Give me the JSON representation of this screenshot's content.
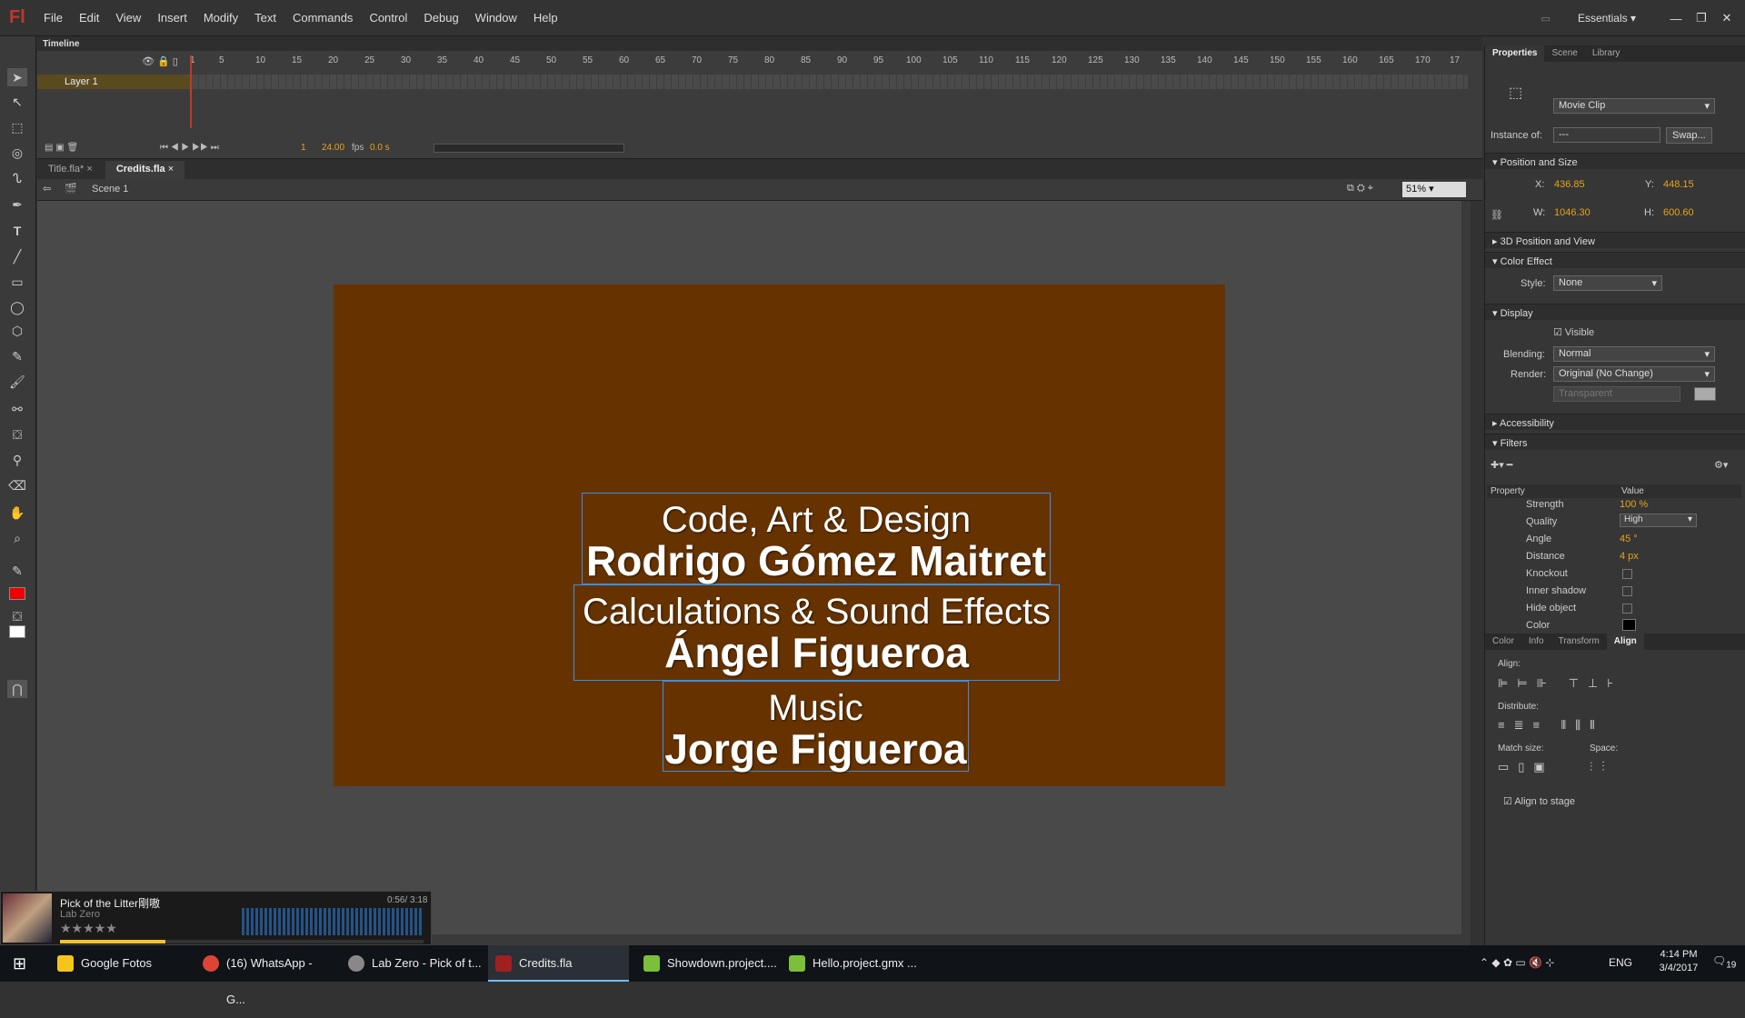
{
  "app": {
    "logo": "Fl",
    "workspace": "Essentials"
  },
  "menu": [
    "File",
    "Edit",
    "View",
    "Insert",
    "Modify",
    "Text",
    "Commands",
    "Control",
    "Debug",
    "Window",
    "Help"
  ],
  "timeline": {
    "title": "Timeline",
    "frame_numbers": [
      "1",
      "5",
      "10",
      "15",
      "20",
      "25",
      "30",
      "35",
      "40",
      "45",
      "50",
      "55",
      "60",
      "65",
      "70",
      "75",
      "80",
      "85",
      "90",
      "95",
      "100",
      "105",
      "110",
      "115",
      "120",
      "125",
      "130",
      "135",
      "140",
      "145",
      "150",
      "155",
      "160",
      "165",
      "170",
      "17"
    ],
    "layer_name": "Layer 1",
    "current_frame": "1",
    "fps": "24.00",
    "fps_unit": "fps",
    "time": "0.0 s"
  },
  "doc_tabs": [
    {
      "label": "Title.fla*",
      "active": false
    },
    {
      "label": "Credits.fla",
      "active": true
    }
  ],
  "scene": {
    "label": "Scene 1",
    "zoom": "51%"
  },
  "stage": {
    "bg_color": "#663300",
    "credits": [
      {
        "role": "Code, Art & Design",
        "name": "Rodrigo Gómez Maitret"
      },
      {
        "role": "Calculations & Sound Effects",
        "name": "Ángel Figueroa"
      },
      {
        "role": "Music",
        "name": "Jorge Figueroa"
      }
    ]
  },
  "properties": {
    "tabs": [
      "Properties",
      "Scene",
      "Library"
    ],
    "symbol_type": "Movie Clip",
    "instance_label": "Instance of:",
    "instance_value": "---",
    "swap_label": "Swap...",
    "pos_section": "Position and Size",
    "x_label": "X:",
    "x": "436.85",
    "y_label": "Y:",
    "y": "448.15",
    "w_label": "W:",
    "w": "1046.30",
    "h_label": "H:",
    "h": "600.60",
    "section_3d": "3D Position and View",
    "color_effect": "Color Effect",
    "style_label": "Style:",
    "style_value": "None",
    "display": "Display",
    "visible_label": "Visible",
    "blending_label": "Blending:",
    "blending_value": "Normal",
    "render_label": "Render:",
    "render_value": "Original (No Change)",
    "transparent_value": "Transparent",
    "accessibility": "Accessibility",
    "filters": "Filters",
    "filter_cols": [
      "Property",
      "Value"
    ],
    "filter_rows": [
      {
        "k": "Strength",
        "v": "100 %"
      },
      {
        "k": "Quality",
        "v": "High"
      },
      {
        "k": "Angle",
        "v": "45 °"
      },
      {
        "k": "Distance",
        "v": "4 px"
      },
      {
        "k": "Knockout",
        "v": ""
      },
      {
        "k": "Inner shadow",
        "v": ""
      },
      {
        "k": "Hide object",
        "v": ""
      },
      {
        "k": "Color",
        "v": ""
      }
    ]
  },
  "align_panel": {
    "tabs": [
      "Color",
      "Info",
      "Transform",
      "Align"
    ],
    "align": "Align:",
    "distribute": "Distribute:",
    "match_size": "Match size:",
    "space": "Space:",
    "align_to_stage": "Align to stage"
  },
  "media": {
    "track": "Pick of the Litter剛嗷",
    "artist": "Lab Zero",
    "time": "0:56/ 3:18"
  },
  "taskbar": {
    "items": [
      "Google Fotos",
      "(16) WhatsApp - G...",
      "Lab Zero - Pick of t...",
      "Credits.fla",
      "Showdown.project....",
      "Hello.project.gmx ..."
    ],
    "lang": "ENG",
    "time": "4:14 PM",
    "date": "3/4/2017",
    "notif_count": "19"
  }
}
